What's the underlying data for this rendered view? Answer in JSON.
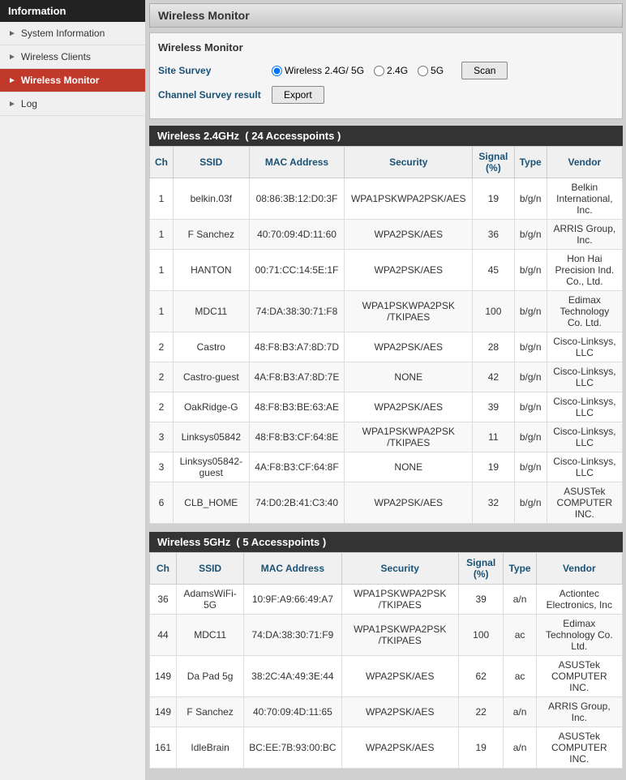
{
  "sidebar": {
    "header": "Information",
    "items": [
      {
        "id": "system-information",
        "label": "System Information",
        "active": false
      },
      {
        "id": "wireless-clients",
        "label": "Wireless Clients",
        "active": false
      },
      {
        "id": "wireless-monitor",
        "label": "Wireless Monitor",
        "active": true
      },
      {
        "id": "log",
        "label": "Log",
        "active": false
      }
    ]
  },
  "page": {
    "header": "Wireless Monitor",
    "card_title": "Wireless Monitor"
  },
  "site_survey": {
    "label": "Site Survey",
    "options": [
      {
        "id": "opt-both",
        "label": "Wireless 2.4G/ 5G",
        "checked": true
      },
      {
        "id": "opt-2g",
        "label": "2.4G",
        "checked": false
      },
      {
        "id": "opt-5g",
        "label": "5G",
        "checked": false
      }
    ],
    "scan_label": "Scan"
  },
  "channel_survey": {
    "label": "Channel Survey result",
    "export_label": "Export"
  },
  "wireless_24ghz": {
    "section_title": "Wireless 2.4GHz",
    "accesspoints_count": "24 Accesspoints",
    "columns": [
      "Ch",
      "SSID",
      "MAC Address",
      "Security",
      "Signal (%)",
      "Type",
      "Vendor"
    ],
    "rows": [
      {
        "ch": "1",
        "ssid": "belkin.03f",
        "mac": "08:86:3B:12:D0:3F",
        "security": "WPA1PSKWPA2PSK/AES",
        "signal": "19",
        "type": "b/g/n",
        "vendor": "Belkin International, Inc."
      },
      {
        "ch": "1",
        "ssid": "F Sanchez",
        "mac": "40:70:09:4D:11:60",
        "security": "WPA2PSK/AES",
        "signal": "36",
        "type": "b/g/n",
        "vendor": "ARRIS Group, Inc."
      },
      {
        "ch": "1",
        "ssid": "HANTON",
        "mac": "00:71:CC:14:5E:1F",
        "security": "WPA2PSK/AES",
        "signal": "45",
        "type": "b/g/n",
        "vendor": "Hon Hai Precision Ind. Co., Ltd."
      },
      {
        "ch": "1",
        "ssid": "MDC11",
        "mac": "74:DA:38:30:71:F8",
        "security": "WPA1PSKWPA2PSK /TKIPAES",
        "signal": "100",
        "type": "b/g/n",
        "vendor": "Edimax Technology Co. Ltd."
      },
      {
        "ch": "2",
        "ssid": "Castro",
        "mac": "48:F8:B3:A7:8D:7D",
        "security": "WPA2PSK/AES",
        "signal": "28",
        "type": "b/g/n",
        "vendor": "Cisco-Linksys, LLC"
      },
      {
        "ch": "2",
        "ssid": "Castro-guest",
        "mac": "4A:F8:B3:A7:8D:7E",
        "security": "NONE",
        "signal": "42",
        "type": "b/g/n",
        "vendor": "Cisco-Linksys, LLC"
      },
      {
        "ch": "2",
        "ssid": "OakRidge-G",
        "mac": "48:F8:B3:BE:63:AE",
        "security": "WPA2PSK/AES",
        "signal": "39",
        "type": "b/g/n",
        "vendor": "Cisco-Linksys, LLC"
      },
      {
        "ch": "3",
        "ssid": "Linksys05842",
        "mac": "48:F8:B3:CF:64:8E",
        "security": "WPA1PSKWPA2PSK /TKIPAES",
        "signal": "11",
        "type": "b/g/n",
        "vendor": "Cisco-Linksys, LLC"
      },
      {
        "ch": "3",
        "ssid": "Linksys05842-guest",
        "mac": "4A:F8:B3:CF:64:8F",
        "security": "NONE",
        "signal": "19",
        "type": "b/g/n",
        "vendor": "Cisco-Linksys, LLC"
      },
      {
        "ch": "6",
        "ssid": "CLB_HOME",
        "mac": "74:D0:2B:41:C3:40",
        "security": "WPA2PSK/AES",
        "signal": "32",
        "type": "b/g/n",
        "vendor": "ASUSTek COMPUTER INC."
      }
    ]
  },
  "wireless_5ghz": {
    "section_title": "Wireless 5GHz",
    "accesspoints_count": "5 Accesspoints",
    "columns": [
      "Ch",
      "SSID",
      "MAC Address",
      "Security",
      "Signal (%)",
      "Type",
      "Vendor"
    ],
    "rows": [
      {
        "ch": "36",
        "ssid": "AdamsWiFi-5G",
        "mac": "10:9F:A9:66:49:A7",
        "security": "WPA1PSKWPA2PSK /TKIPAES",
        "signal": "39",
        "type": "a/n",
        "vendor": "Actiontec Electronics, Inc"
      },
      {
        "ch": "44",
        "ssid": "MDC11",
        "mac": "74:DA:38:30:71:F9",
        "security": "WPA1PSKWPA2PSK /TKIPAES",
        "signal": "100",
        "type": "ac",
        "vendor": "Edimax Technology Co. Ltd."
      },
      {
        "ch": "149",
        "ssid": "Da Pad 5g",
        "mac": "38:2C:4A:49:3E:44",
        "security": "WPA2PSK/AES",
        "signal": "62",
        "type": "ac",
        "vendor": "ASUSTek COMPUTER INC."
      },
      {
        "ch": "149",
        "ssid": "F Sanchez",
        "mac": "40:70:09:4D:11:65",
        "security": "WPA2PSK/AES",
        "signal": "22",
        "type": "a/n",
        "vendor": "ARRIS Group, Inc."
      },
      {
        "ch": "161",
        "ssid": "IdleBrain",
        "mac": "BC:EE:7B:93:00:BC",
        "security": "WPA2PSK/AES",
        "signal": "19",
        "type": "a/n",
        "vendor": "ASUSTek COMPUTER INC."
      }
    ]
  }
}
